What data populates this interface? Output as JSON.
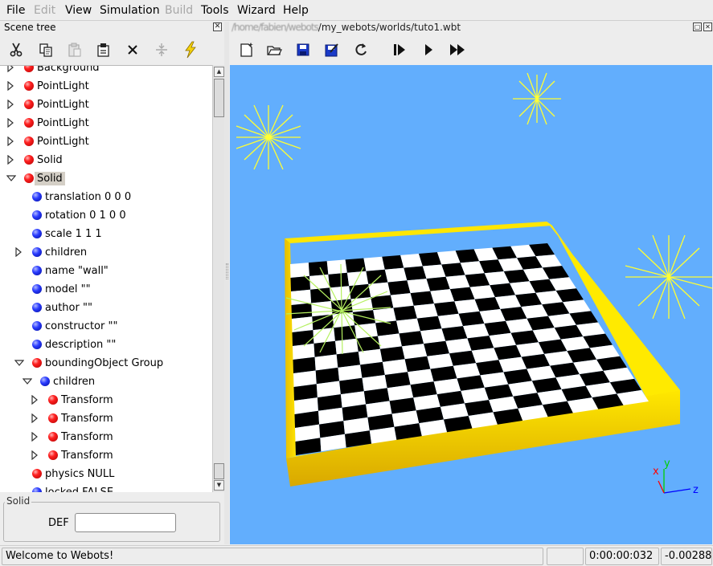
{
  "menubar": {
    "items": [
      {
        "label": "File",
        "enabled": true
      },
      {
        "label": "Edit",
        "enabled": false
      },
      {
        "label": "View",
        "enabled": true
      },
      {
        "label": "Simulation",
        "enabled": true
      },
      {
        "label": "Build",
        "enabled": false
      },
      {
        "label": "Tools",
        "enabled": true
      },
      {
        "label": "Wizard",
        "enabled": true
      },
      {
        "label": "Help",
        "enabled": true
      }
    ]
  },
  "scene_tree": {
    "title": "Scene tree",
    "close_glyph": "✕",
    "toolbar": [
      {
        "name": "cut",
        "icon": "scissors-icon"
      },
      {
        "name": "copy",
        "icon": "copy-icon"
      },
      {
        "name": "paste",
        "icon": "paste-icon",
        "enabled": false
      },
      {
        "name": "insert-after",
        "icon": "insert-icon"
      },
      {
        "name": "delete",
        "icon": "delete-icon"
      },
      {
        "name": "reset",
        "icon": "reset-field-icon",
        "enabled": false
      },
      {
        "name": "transform",
        "icon": "lightning-icon"
      }
    ],
    "nodes": [
      {
        "label": "Background",
        "ball": "red",
        "arrow": "right"
      },
      {
        "label": "PointLight",
        "ball": "red",
        "arrow": "right"
      },
      {
        "label": "PointLight",
        "ball": "red",
        "arrow": "right"
      },
      {
        "label": "PointLight",
        "ball": "red",
        "arrow": "right"
      },
      {
        "label": "PointLight",
        "ball": "red",
        "arrow": "right"
      },
      {
        "label": "Solid",
        "ball": "red",
        "arrow": "right"
      },
      {
        "label": "Solid",
        "ball": "red",
        "arrow": "down",
        "selected": true
      },
      {
        "label": "translation 0 0 0",
        "ball": "blue",
        "arrow": "none"
      },
      {
        "label": "rotation 0 1 0 0",
        "ball": "blue",
        "arrow": "none"
      },
      {
        "label": "scale 1 1 1",
        "ball": "blue",
        "arrow": "none"
      },
      {
        "label": "children",
        "ball": "blue",
        "arrow": "right"
      },
      {
        "label": "name \"wall\"",
        "ball": "blue",
        "arrow": "none"
      },
      {
        "label": "model \"\"",
        "ball": "blue",
        "arrow": "none"
      },
      {
        "label": "author \"\"",
        "ball": "blue",
        "arrow": "none"
      },
      {
        "label": "constructor \"\"",
        "ball": "blue",
        "arrow": "none"
      },
      {
        "label": "description \"\"",
        "ball": "blue",
        "arrow": "none"
      },
      {
        "label": "boundingObject Group",
        "ball": "red",
        "arrow": "down"
      },
      {
        "label": "children",
        "ball": "blue",
        "arrow": "down"
      },
      {
        "label": "Transform",
        "ball": "red",
        "arrow": "right"
      },
      {
        "label": "Transform",
        "ball": "red",
        "arrow": "right"
      },
      {
        "label": "Transform",
        "ball": "red",
        "arrow": "right"
      },
      {
        "label": "Transform",
        "ball": "red",
        "arrow": "right"
      },
      {
        "label": "physics NULL",
        "ball": "red",
        "arrow": "none"
      },
      {
        "label": "locked FALSE",
        "ball": "blue",
        "arrow": "none"
      }
    ],
    "scroll_up_glyph": "▲",
    "scroll_down_glyph": "▼",
    "def_group": {
      "legend": "Solid",
      "label": "DEF",
      "value": ""
    }
  },
  "world": {
    "path_blurred": "/home/fabien/webots",
    "path": "/my_webots/worlds/tuto1.wbt",
    "window_buttons": [
      "▢",
      "✕"
    ],
    "toolbar": [
      {
        "name": "new-world",
        "icon": "new-document-icon"
      },
      {
        "name": "open-world",
        "icon": "open-icon"
      },
      {
        "name": "save-world",
        "icon": "save-icon"
      },
      {
        "name": "save-as",
        "icon": "save-as-icon"
      },
      {
        "name": "revert",
        "icon": "revert-icon"
      },
      {
        "name": "step",
        "icon": "step-icon"
      },
      {
        "name": "run",
        "icon": "play-icon"
      },
      {
        "name": "fast",
        "icon": "fast-forward-icon"
      }
    ],
    "axes": {
      "x": "x",
      "y": "y",
      "z": "z"
    },
    "colors": {
      "sky": "#62aefd",
      "wall": "#f5d400",
      "light": "#ffff33",
      "axis_x": "#ff0000",
      "axis_y": "#00d000",
      "axis_z": "#0000ff"
    }
  },
  "statusbar": {
    "message": "Welcome to Webots!",
    "time": "0:00:00:032",
    "value": "-0.00288"
  }
}
